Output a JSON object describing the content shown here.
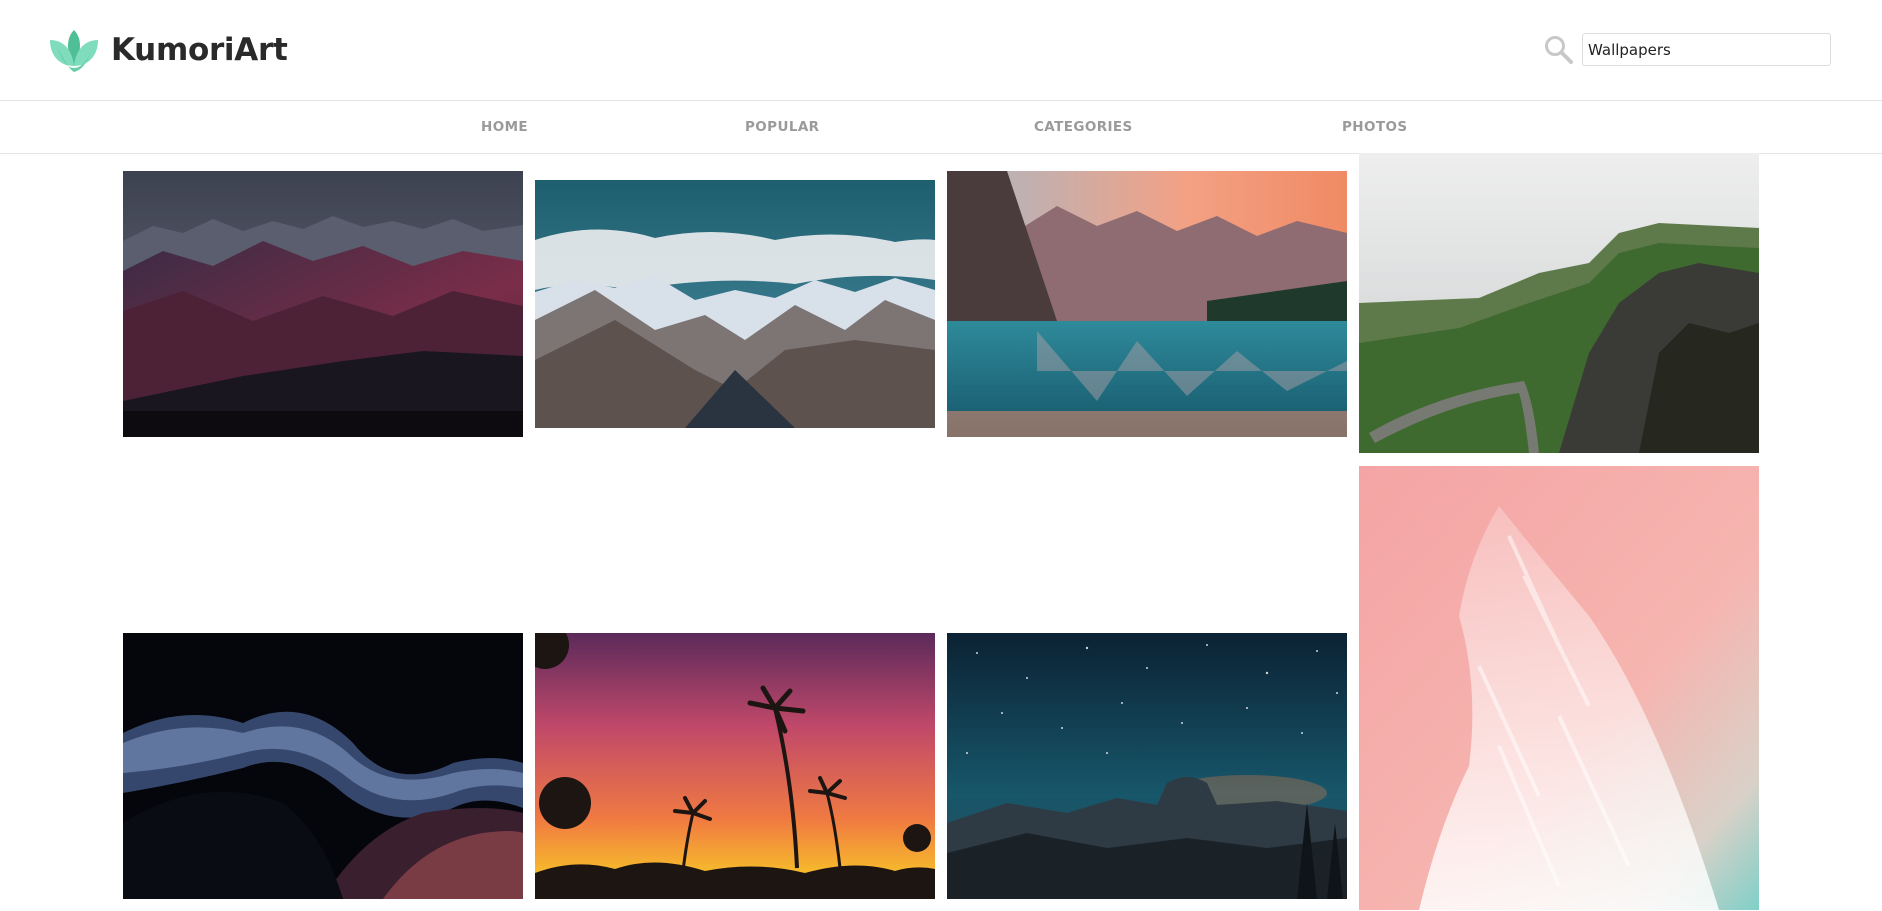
{
  "brand": {
    "name": "KumoriArt",
    "accent": "#6fd3b0"
  },
  "search": {
    "icon": "search-icon",
    "value": "Wallpapers"
  },
  "nav": {
    "items": [
      {
        "label": "HOME"
      },
      {
        "label": "POPULAR"
      },
      {
        "label": "CATEGORIES"
      },
      {
        "label": "PHOTOS"
      }
    ]
  },
  "gallery": {
    "photos": [
      {
        "subject": "dark purple mountain range at dusk"
      },
      {
        "subject": "snowy mountains under blue sky with clouds"
      },
      {
        "subject": "mountain lake with reflection at sunrise"
      },
      {
        "subject": "green highland cliffs with winding road"
      },
      {
        "subject": "pink sky with white streaked clouds"
      },
      {
        "subject": "milky way through canyon silhouette"
      },
      {
        "subject": "tropical palm trees at sunset"
      },
      {
        "subject": "starry night over valley and half dome"
      }
    ]
  }
}
